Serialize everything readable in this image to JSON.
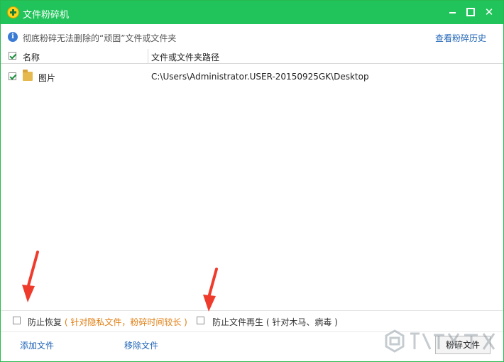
{
  "window": {
    "title": "文件粉碎机",
    "controls": [
      "minimize",
      "maximize",
      "close"
    ],
    "accent_color": "#21c45b"
  },
  "info": {
    "icon": "info-icon",
    "text": "彻底粉碎无法删除的“顽固”文件或文件夹",
    "history_link": "查看粉碎历史"
  },
  "table": {
    "columns": [
      "名称",
      "文件或文件夹路径"
    ],
    "rows": [
      {
        "checked": true,
        "name": "图片",
        "path": "C:\\Users\\Administrator.USER-20150925GK\\Desktop"
      }
    ]
  },
  "options": {
    "prevent_recovery_label": "防止恢复",
    "prevent_recovery_note": "( 针对隐私文件，粉碎时间较长 )",
    "prevent_regeneration_label": "防止文件再生",
    "prevent_regeneration_note": "( 针对木马、病毒 )"
  },
  "footer": {
    "add_file": "添加文件",
    "remove_file": "移除文件",
    "shred_button": "粉碎文件"
  },
  "colors": {
    "arrow": "#ef3b2c",
    "link": "#1e63b6",
    "note": "#e07e12"
  }
}
